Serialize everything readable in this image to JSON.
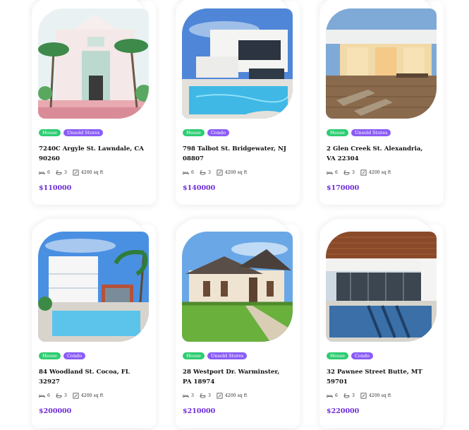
{
  "listings": [
    {
      "type": "House",
      "status": "Unsold Stores",
      "address": "7240C Argyle St. Lawndale, CA 90260",
      "beds": "6",
      "baths": "3",
      "area": "4200 sq ft",
      "price": "$110000",
      "image": "pink-villa-with-palms"
    },
    {
      "type": "House",
      "status": "Condo",
      "address": "798 Talbot St. Bridgewater, NJ 08807",
      "beds": "6",
      "baths": "3",
      "area": "4200 sq ft",
      "price": "$140000",
      "image": "modern-white-house-pool"
    },
    {
      "type": "House",
      "status": "Unsold Stores",
      "address": "2 Glen Creek St. Alexandria, VA 22304",
      "beds": "6",
      "baths": "3",
      "area": "4200 sq ft",
      "price": "$170000",
      "image": "patio-deck-dusk"
    },
    {
      "type": "House",
      "status": "Condo",
      "address": "84 Woodland St. Cocoa, FL 32927",
      "beds": "6",
      "baths": "3",
      "area": "4200 sq ft",
      "price": "$200000",
      "image": "beach-house-pool"
    },
    {
      "type": "House",
      "status": "Unsold Stores",
      "address": "28 Westport Dr. Warminster, PA 18974",
      "beds": "3",
      "baths": "3",
      "area": "4200 sq ft",
      "price": "$210000",
      "image": "suburban-house-lawn"
    },
    {
      "type": "House",
      "status": "Condo",
      "address": "32 Pawnee Street Butte, MT 59701",
      "beds": "6",
      "baths": "3",
      "area": "4200 sq ft",
      "price": "$220000",
      "image": "modern-villa-pool-wood"
    }
  ],
  "icons": {
    "bed": "bed-icon",
    "bath": "bath-icon",
    "area": "area-icon"
  },
  "colors": {
    "type_tag": "#2ecc71",
    "status_tag": "#8a5cf6",
    "price": "#6c2bd9"
  }
}
